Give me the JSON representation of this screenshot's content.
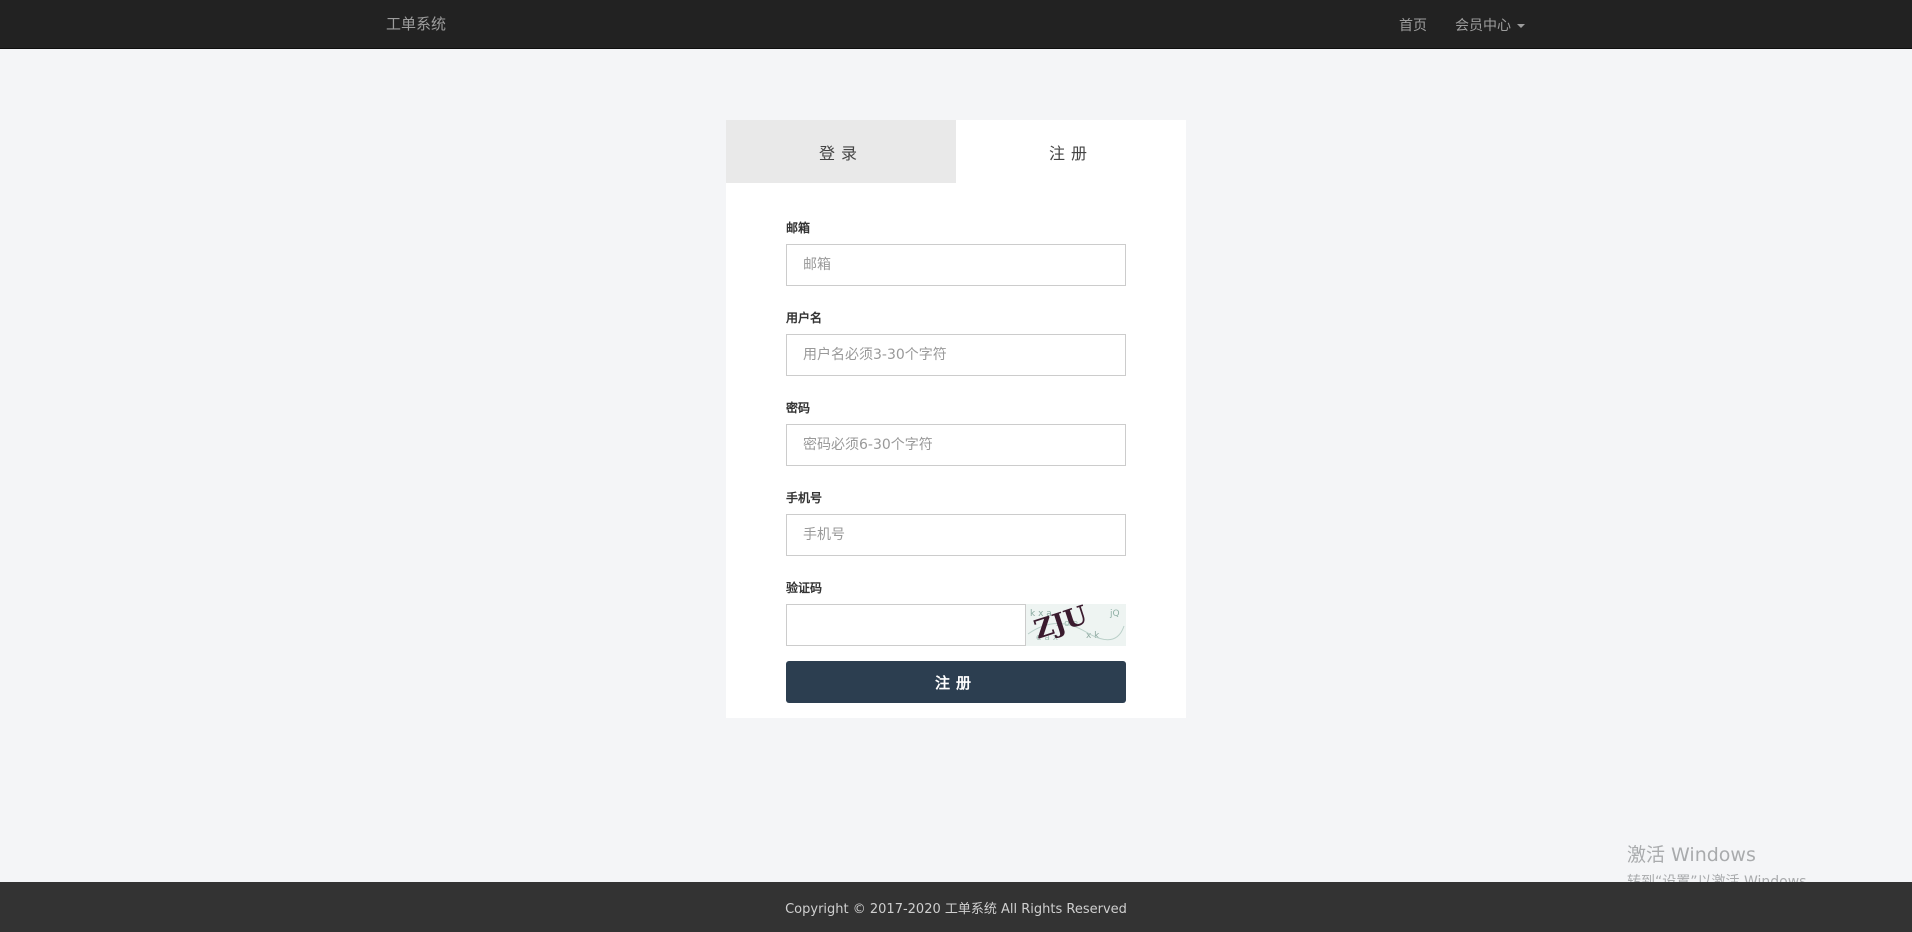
{
  "navbar": {
    "brand": "工单系统",
    "links": [
      {
        "label": "首页"
      },
      {
        "label": "会员中心"
      }
    ]
  },
  "panel": {
    "tabs": [
      {
        "label": "登录",
        "active": false
      },
      {
        "label": "注册",
        "active": true
      }
    ],
    "form": {
      "email": {
        "label": "邮箱",
        "placeholder": "邮箱",
        "value": ""
      },
      "username": {
        "label": "用户名",
        "placeholder": "用户名必须3-30个字符",
        "value": ""
      },
      "password": {
        "label": "密码",
        "placeholder": "密码必须6-30个字符",
        "value": ""
      },
      "phone": {
        "label": "手机号",
        "placeholder": "手机号",
        "value": ""
      },
      "captcha": {
        "label": "验证码",
        "value": "",
        "image_text": "ZJU"
      },
      "submit_label": "注册"
    }
  },
  "watermark": {
    "title": "激活 Windows",
    "subtitle": "转到“设置”以激活 Windows。"
  },
  "footer": {
    "text": "Copyright © 2017-2020 工单系统 All Rights Reserved"
  },
  "colors": {
    "navbar": "#222222",
    "background": "#f4f5f7",
    "submit_button": "#2c3e50",
    "footer": "#333333"
  }
}
